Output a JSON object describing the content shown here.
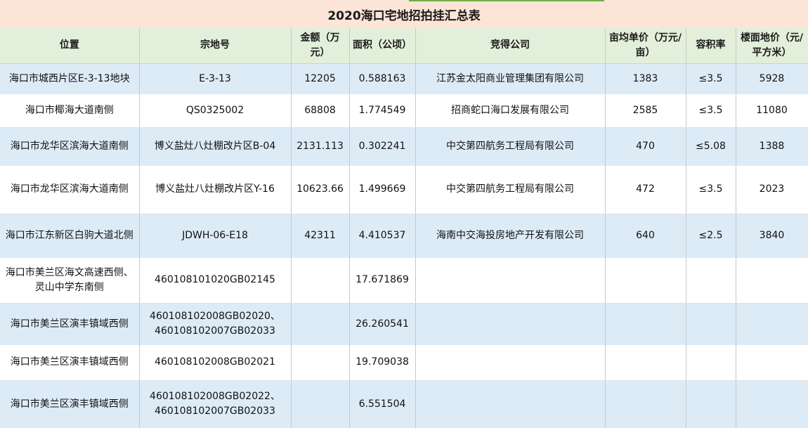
{
  "title": "2020海口宅地招拍挂汇总表",
  "headers": [
    "位置",
    "宗地号",
    "金额（万元）",
    "面积（公顷）",
    "竞得公司",
    "亩均单价（万元/亩）",
    "容积率",
    "楼面地价（元/平方米）"
  ],
  "rows": [
    {
      "location": "海口市城西片区E-3-13地块",
      "parcel": "E-3-13",
      "amount": "12205",
      "area": "0.588163",
      "company": "江苏金太阳商业管理集团有限公司",
      "price_per_mu": "1383",
      "plot_ratio": "≤3.5",
      "floor_price": "5928"
    },
    {
      "location": "海口市椰海大道南侧",
      "parcel": "QS0325002",
      "amount": "68808",
      "area": "1.774549",
      "company": "招商蛇口海口发展有限公司",
      "price_per_mu": "2585",
      "plot_ratio": "≤3.5",
      "floor_price": "11080"
    },
    {
      "location": "海口市龙华区滨海大道南侧",
      "parcel": "博义盐灶八灶棚改片区B-04",
      "amount": "2131.113",
      "area": "0.302241",
      "company": "中交第四航务工程局有限公司",
      "price_per_mu": "470",
      "plot_ratio": "≤5.08",
      "floor_price": "1388"
    },
    {
      "location": "海口市龙华区滨海大道南侧",
      "parcel": "博义盐灶八灶棚改片区Y-16",
      "amount": "10623.66",
      "area": "1.499669",
      "company": "中交第四航务工程局有限公司",
      "price_per_mu": "472",
      "plot_ratio": "≤3.5",
      "floor_price": "2023"
    },
    {
      "location": "海口市江东新区白驹大道北侧",
      "parcel": "JDWH-06-E18",
      "amount": "42311",
      "area": "4.410537",
      "company": "海南中交海投房地产开发有限公司",
      "price_per_mu": "640",
      "plot_ratio": "≤2.5",
      "floor_price": "3840"
    },
    {
      "location": "海口市美兰区海文高速西侧、灵山中学东南侧",
      "parcel": "460108101020GB02145",
      "amount": "",
      "area": "17.671869",
      "company": "",
      "price_per_mu": "",
      "plot_ratio": "",
      "floor_price": ""
    },
    {
      "location": "海口市美兰区演丰镇域西侧",
      "parcel": "460108102008GB02020、460108102007GB02033",
      "amount": "",
      "area": "26.260541",
      "company": "",
      "price_per_mu": "",
      "plot_ratio": "",
      "floor_price": ""
    },
    {
      "location": "海口市美兰区演丰镇域西侧",
      "parcel": "460108102008GB02021",
      "amount": "",
      "area": "19.709038",
      "company": "",
      "price_per_mu": "",
      "plot_ratio": "",
      "floor_price": ""
    },
    {
      "location": "海口市美兰区演丰镇域西侧",
      "parcel": "460108102008GB02022、460108102007GB02033",
      "amount": "",
      "area": "6.551504",
      "company": "",
      "price_per_mu": "",
      "plot_ratio": "",
      "floor_price": ""
    }
  ],
  "colors": {
    "title_bg": "#fce4d6",
    "header_bg": "#e2efda",
    "band_blue": "#ddebf7",
    "white": "#ffffff",
    "accent_green": "#70ad47"
  }
}
